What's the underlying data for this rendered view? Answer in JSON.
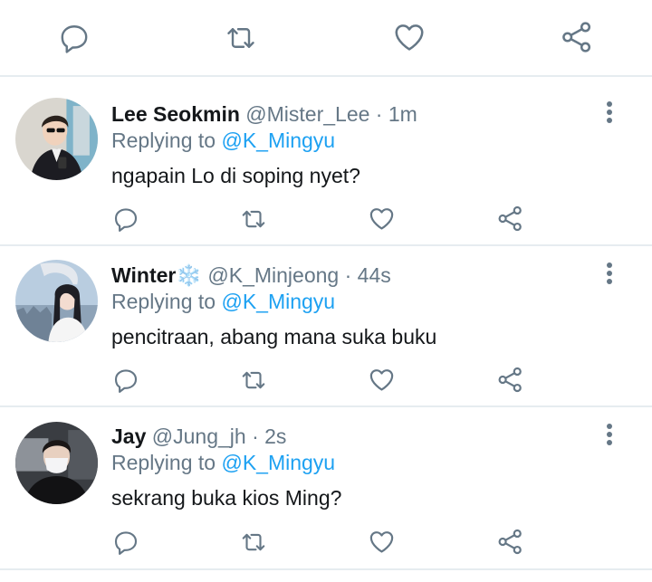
{
  "colors": {
    "icon": "#657786",
    "mention": "#1da1f2",
    "text": "#14171a",
    "divider": "#e6ecf0"
  },
  "top_actions": [
    "reply-icon",
    "retweet-icon",
    "like-icon",
    "share-icon"
  ],
  "replies": [
    {
      "name": "Lee Seokmin",
      "name_suffix": "",
      "handle": "@Mister_Lee",
      "separator": "·",
      "time": "1m",
      "replying_label": "Replying to",
      "mention": "@K_Mingyu",
      "text": "ngapain Lo di soping nyet?"
    },
    {
      "name": "Winter",
      "name_suffix": "❄️",
      "handle": "@K_Minjeong",
      "separator": "·",
      "time": "44s",
      "replying_label": "Replying to",
      "mention": "@K_Mingyu",
      "text": "pencitraan, abang mana suka buku"
    },
    {
      "name": "Jay",
      "name_suffix": "",
      "handle": "@Jung_jh",
      "separator": "·",
      "time": "2s",
      "replying_label": "Replying to",
      "mention": "@K_Mingyu",
      "text": "sekrang buka kios Ming?"
    }
  ]
}
